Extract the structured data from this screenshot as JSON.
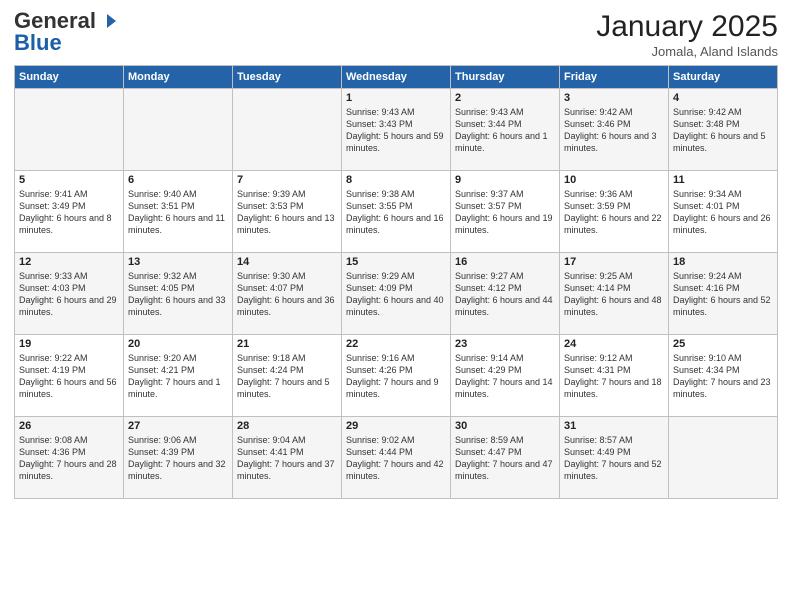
{
  "header": {
    "logo_general": "General",
    "logo_blue": "Blue",
    "month": "January 2025",
    "location": "Jomala, Aland Islands"
  },
  "days_of_week": [
    "Sunday",
    "Monday",
    "Tuesday",
    "Wednesday",
    "Thursday",
    "Friday",
    "Saturday"
  ],
  "weeks": [
    [
      {
        "day": "",
        "info": ""
      },
      {
        "day": "",
        "info": ""
      },
      {
        "day": "",
        "info": ""
      },
      {
        "day": "1",
        "info": "Sunrise: 9:43 AM\nSunset: 3:43 PM\nDaylight: 5 hours\nand 59 minutes."
      },
      {
        "day": "2",
        "info": "Sunrise: 9:43 AM\nSunset: 3:44 PM\nDaylight: 6 hours\nand 1 minute."
      },
      {
        "day": "3",
        "info": "Sunrise: 9:42 AM\nSunset: 3:46 PM\nDaylight: 6 hours\nand 3 minutes."
      },
      {
        "day": "4",
        "info": "Sunrise: 9:42 AM\nSunset: 3:48 PM\nDaylight: 6 hours\nand 5 minutes."
      }
    ],
    [
      {
        "day": "5",
        "info": "Sunrise: 9:41 AM\nSunset: 3:49 PM\nDaylight: 6 hours\nand 8 minutes."
      },
      {
        "day": "6",
        "info": "Sunrise: 9:40 AM\nSunset: 3:51 PM\nDaylight: 6 hours\nand 11 minutes."
      },
      {
        "day": "7",
        "info": "Sunrise: 9:39 AM\nSunset: 3:53 PM\nDaylight: 6 hours\nand 13 minutes."
      },
      {
        "day": "8",
        "info": "Sunrise: 9:38 AM\nSunset: 3:55 PM\nDaylight: 6 hours\nand 16 minutes."
      },
      {
        "day": "9",
        "info": "Sunrise: 9:37 AM\nSunset: 3:57 PM\nDaylight: 6 hours\nand 19 minutes."
      },
      {
        "day": "10",
        "info": "Sunrise: 9:36 AM\nSunset: 3:59 PM\nDaylight: 6 hours\nand 22 minutes."
      },
      {
        "day": "11",
        "info": "Sunrise: 9:34 AM\nSunset: 4:01 PM\nDaylight: 6 hours\nand 26 minutes."
      }
    ],
    [
      {
        "day": "12",
        "info": "Sunrise: 9:33 AM\nSunset: 4:03 PM\nDaylight: 6 hours\nand 29 minutes."
      },
      {
        "day": "13",
        "info": "Sunrise: 9:32 AM\nSunset: 4:05 PM\nDaylight: 6 hours\nand 33 minutes."
      },
      {
        "day": "14",
        "info": "Sunrise: 9:30 AM\nSunset: 4:07 PM\nDaylight: 6 hours\nand 36 minutes."
      },
      {
        "day": "15",
        "info": "Sunrise: 9:29 AM\nSunset: 4:09 PM\nDaylight: 6 hours\nand 40 minutes."
      },
      {
        "day": "16",
        "info": "Sunrise: 9:27 AM\nSunset: 4:12 PM\nDaylight: 6 hours\nand 44 minutes."
      },
      {
        "day": "17",
        "info": "Sunrise: 9:25 AM\nSunset: 4:14 PM\nDaylight: 6 hours\nand 48 minutes."
      },
      {
        "day": "18",
        "info": "Sunrise: 9:24 AM\nSunset: 4:16 PM\nDaylight: 6 hours\nand 52 minutes."
      }
    ],
    [
      {
        "day": "19",
        "info": "Sunrise: 9:22 AM\nSunset: 4:19 PM\nDaylight: 6 hours\nand 56 minutes."
      },
      {
        "day": "20",
        "info": "Sunrise: 9:20 AM\nSunset: 4:21 PM\nDaylight: 7 hours\nand 1 minute."
      },
      {
        "day": "21",
        "info": "Sunrise: 9:18 AM\nSunset: 4:24 PM\nDaylight: 7 hours\nand 5 minutes."
      },
      {
        "day": "22",
        "info": "Sunrise: 9:16 AM\nSunset: 4:26 PM\nDaylight: 7 hours\nand 9 minutes."
      },
      {
        "day": "23",
        "info": "Sunrise: 9:14 AM\nSunset: 4:29 PM\nDaylight: 7 hours\nand 14 minutes."
      },
      {
        "day": "24",
        "info": "Sunrise: 9:12 AM\nSunset: 4:31 PM\nDaylight: 7 hours\nand 18 minutes."
      },
      {
        "day": "25",
        "info": "Sunrise: 9:10 AM\nSunset: 4:34 PM\nDaylight: 7 hours\nand 23 minutes."
      }
    ],
    [
      {
        "day": "26",
        "info": "Sunrise: 9:08 AM\nSunset: 4:36 PM\nDaylight: 7 hours\nand 28 minutes."
      },
      {
        "day": "27",
        "info": "Sunrise: 9:06 AM\nSunset: 4:39 PM\nDaylight: 7 hours\nand 32 minutes."
      },
      {
        "day": "28",
        "info": "Sunrise: 9:04 AM\nSunset: 4:41 PM\nDaylight: 7 hours\nand 37 minutes."
      },
      {
        "day": "29",
        "info": "Sunrise: 9:02 AM\nSunset: 4:44 PM\nDaylight: 7 hours\nand 42 minutes."
      },
      {
        "day": "30",
        "info": "Sunrise: 8:59 AM\nSunset: 4:47 PM\nDaylight: 7 hours\nand 47 minutes."
      },
      {
        "day": "31",
        "info": "Sunrise: 8:57 AM\nSunset: 4:49 PM\nDaylight: 7 hours\nand 52 minutes."
      },
      {
        "day": "",
        "info": ""
      }
    ]
  ]
}
